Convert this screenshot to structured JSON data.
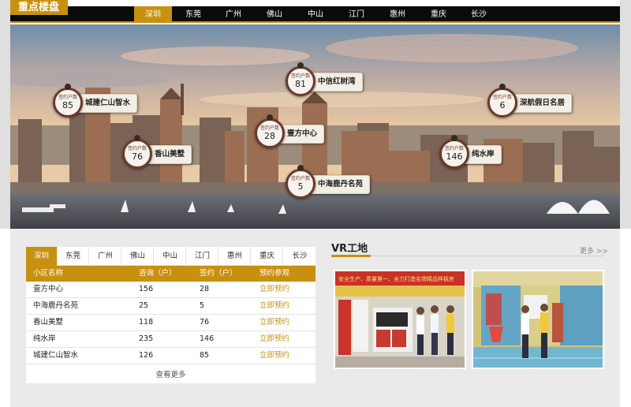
{
  "header": {
    "title": "重点楼盘",
    "cities": [
      "深圳",
      "东莞",
      "广州",
      "佛山",
      "中山",
      "江门",
      "惠州",
      "重庆",
      "长沙"
    ],
    "active_city": "深圳"
  },
  "hero": {
    "marker_label": "签约户数",
    "markers": [
      {
        "name": "城建仁山智水",
        "count": "85"
      },
      {
        "name": "中信红树湾",
        "count": "81"
      },
      {
        "name": "深航假日名居",
        "count": "6"
      },
      {
        "name": "壹方中心",
        "count": "28"
      },
      {
        "name": "香山美墅",
        "count": "76"
      },
      {
        "name": "纯水岸",
        "count": "146"
      },
      {
        "name": "中海鹿丹名苑",
        "count": "5"
      }
    ]
  },
  "table_panel": {
    "tabs": [
      "深圳",
      "东莞",
      "广州",
      "佛山",
      "中山",
      "江门",
      "惠州",
      "重庆",
      "长沙"
    ],
    "active_tab": "深圳",
    "columns": [
      "小区名称",
      "咨询（户）",
      "签约（户）",
      "预约参观"
    ],
    "rows": [
      {
        "name": "壹方中心",
        "consult": "156",
        "signed": "28",
        "action": "立即预约"
      },
      {
        "name": "中海鹿丹名苑",
        "consult": "25",
        "signed": "5",
        "action": "立即预约"
      },
      {
        "name": "香山美墅",
        "consult": "118",
        "signed": "76",
        "action": "立即预约"
      },
      {
        "name": "纯水岸",
        "consult": "235",
        "signed": "146",
        "action": "立即预约"
      },
      {
        "name": "城建仁山智水",
        "consult": "126",
        "signed": "85",
        "action": "立即预约"
      }
    ],
    "more_label": "查看更多"
  },
  "vr": {
    "title": "VR工地",
    "more_label": "更多 >>",
    "banner_text": "安全生产、质量第一、全力打造名牌精品样板房"
  },
  "colors": {
    "accent": "#c8900f",
    "dark_bar": "#0b0b0b",
    "marker_ring": "#6a3a2c",
    "panel_bg": "#eaeaea"
  }
}
